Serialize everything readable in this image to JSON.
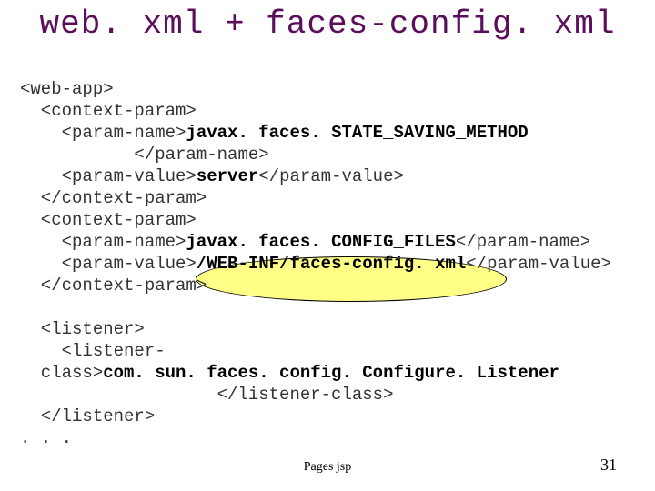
{
  "title": "web. xml + faces-config. xml",
  "code": {
    "l1": "<web-app>",
    "l2": "  <context-param>",
    "l3a": "    <param-name>",
    "l3b": "javax. faces. STATE_SAVING_METHOD",
    "l4": "           </param-name>",
    "l5a": "    <param-value>",
    "l5b": "server",
    "l5c": "</param-value>",
    "l6": "  </context-param>",
    "l7": "  <context-param>",
    "l8a": "    <param-name>",
    "l8b": "javax. faces. CONFIG_FILES",
    "l8c": "</param-name>",
    "l9a": "    <param-value>",
    "l9b": "/WEB-INF/faces-config. xml",
    "l9c": "</param-value>",
    "l10": "  </context-param>",
    "blank": "",
    "l11": "  <listener>",
    "l12": "    <listener-",
    "l13a": "  class>",
    "l13b": "com. sun. faces. config. Configure. Listener",
    "l14": "                   </listener-class>",
    "l15": "  </listener>",
    "l16": ". . ."
  },
  "footer_center": "Pages jsp",
  "page_number": "31",
  "highlight_text": "/WEB-INF/faces-config. xml"
}
